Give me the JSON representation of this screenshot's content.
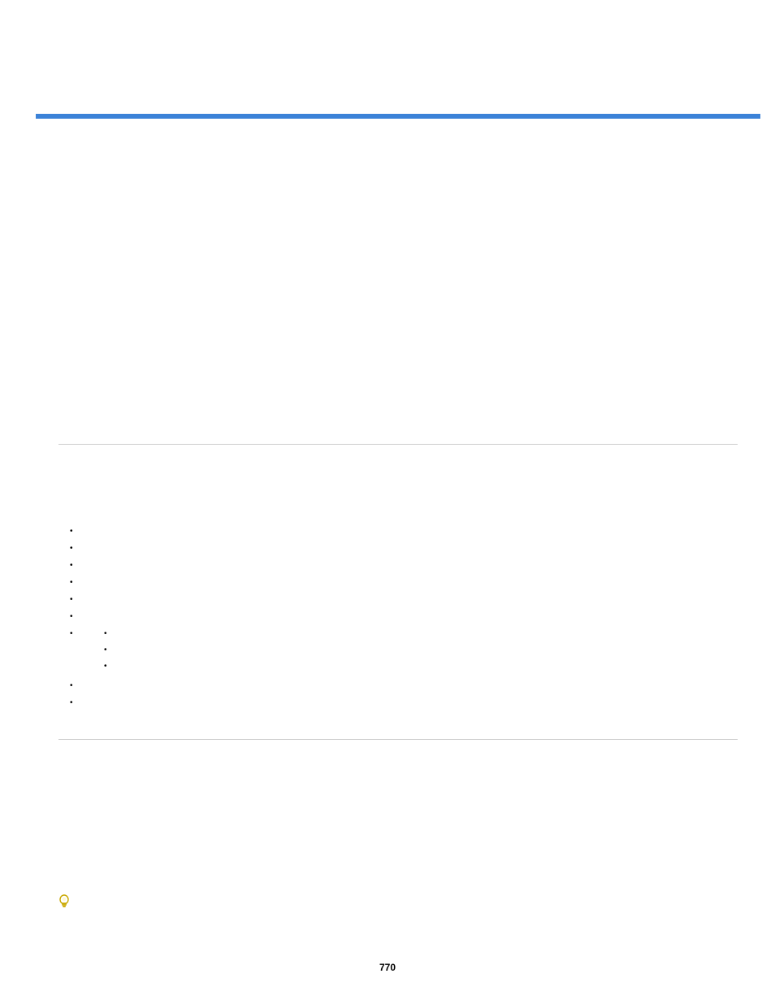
{
  "page": {
    "number": "770"
  },
  "list": {
    "items": [
      {
        "text": ""
      },
      {
        "text": ""
      },
      {
        "text": ""
      },
      {
        "text": ""
      },
      {
        "text": ""
      },
      {
        "text": ""
      },
      {
        "text": "",
        "sub": [
          {
            "text": ""
          },
          {
            "text": ""
          },
          {
            "text": ""
          }
        ]
      },
      {
        "text": ""
      },
      {
        "text": ""
      }
    ]
  },
  "icons": {
    "tip": "lightbulb-icon"
  }
}
